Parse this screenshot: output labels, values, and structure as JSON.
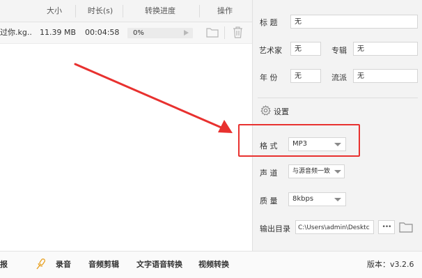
{
  "table": {
    "headers": {
      "size": "大小",
      "duration": "时长(s)",
      "progress": "转换进度",
      "actions": "操作"
    },
    "rows": [
      {
        "name": "过你.kg...",
        "size": "11.39 MB",
        "duration": "00:04:58",
        "progress_text": "0%",
        "progress": 0
      }
    ]
  },
  "meta": {
    "title_label": "标 题",
    "title_value": "无",
    "artist_label": "艺术家",
    "artist_value": "无",
    "album_label": "专辑",
    "album_value": "无",
    "year_label": "年 份",
    "year_value": "无",
    "genre_label": "流派",
    "genre_value": "无"
  },
  "settings": {
    "header": "设置",
    "format_label": "格 式",
    "format_value": "MP3",
    "channel_label": "声 道",
    "channel_value": "与源音频一致",
    "quality_label": "质 量",
    "quality_value": "8kbps",
    "output_label": "输出目录",
    "output_value": "C:\\Users\\admin\\Desktc",
    "more_label": "•••"
  },
  "bottom": {
    "partial": "报",
    "record": "录音",
    "audio_edit": "音频剪辑",
    "tts": "文字语音转换",
    "video_convert": "视频转换",
    "version": "版本：v3.2.6"
  },
  "colors": {
    "accent": "#e8312f",
    "progress": "#5ab0ff",
    "panel": "#f3f3f3"
  }
}
